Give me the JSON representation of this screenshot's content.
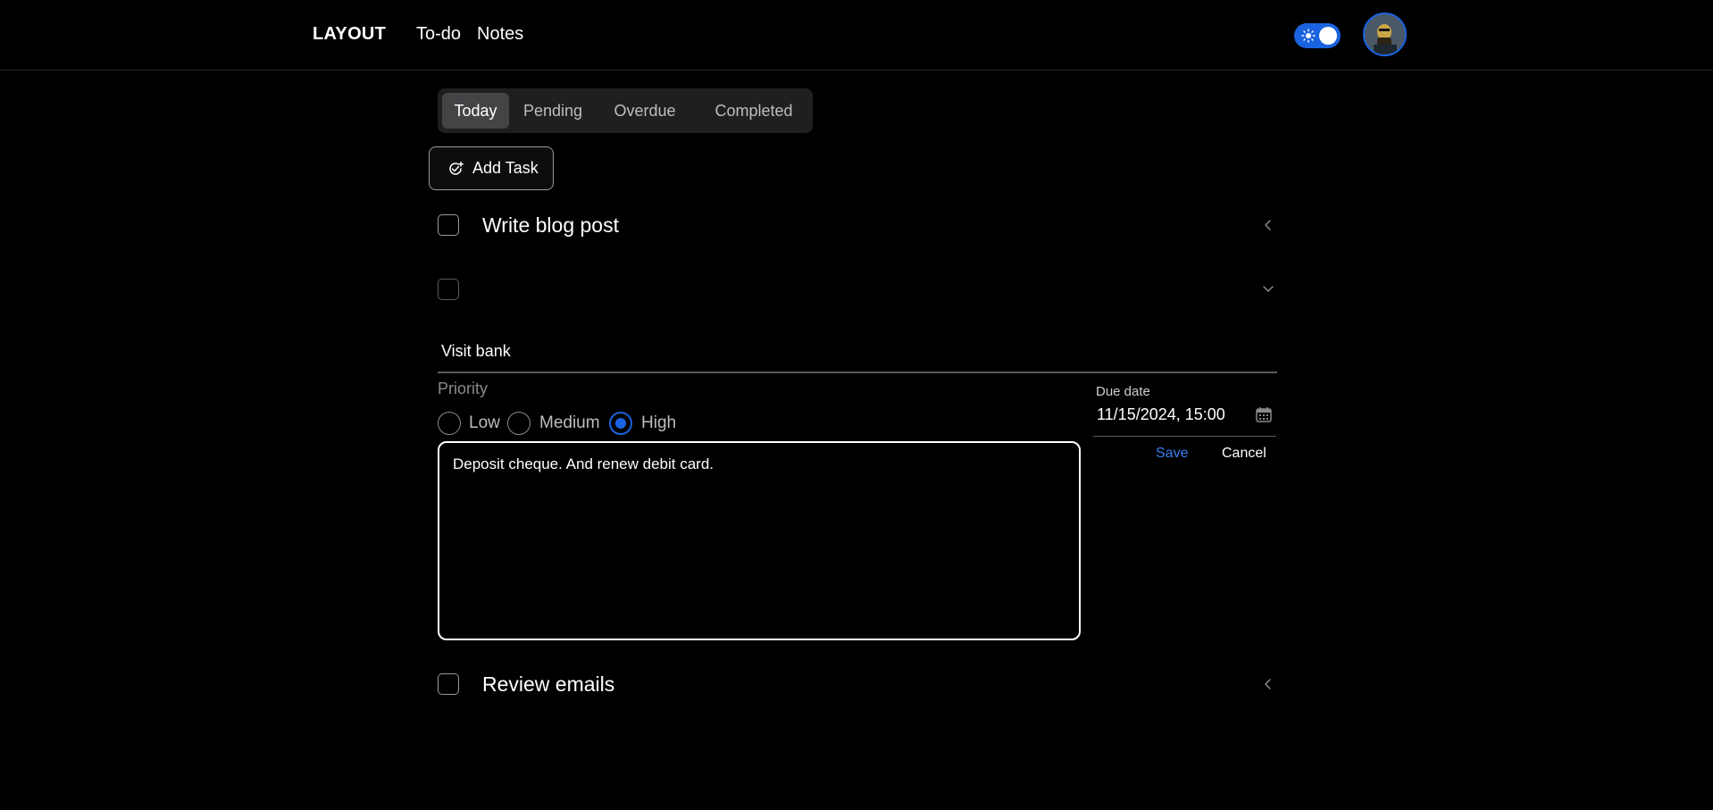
{
  "header": {
    "logo": "LAYOUT",
    "nav": [
      {
        "label": "To-do"
      },
      {
        "label": "Notes"
      }
    ],
    "theme_toggle": {
      "state": "on",
      "icon": "sun-icon"
    },
    "avatar_icon": "user-avatar"
  },
  "tabs": [
    {
      "label": "Today",
      "active": true
    },
    {
      "label": "Pending",
      "active": false
    },
    {
      "label": "Overdue",
      "active": false
    },
    {
      "label": "Completed",
      "active": false
    }
  ],
  "add_task_label": "Add Task",
  "tasks": [
    {
      "title": "Write blog post",
      "checked": false,
      "expanded": false
    },
    {
      "title": "",
      "checked": false,
      "expanded": true
    },
    {
      "title": "Review emails",
      "checked": false,
      "expanded": false
    }
  ],
  "edit_form": {
    "title_value": "Visit bank",
    "priority_label": "Priority",
    "priorities": [
      {
        "label": "Low",
        "checked": false
      },
      {
        "label": "Medium",
        "checked": false
      },
      {
        "label": "High",
        "checked": true
      }
    ],
    "description": "Deposit cheque. And renew debit card.",
    "due_label": "Due date",
    "due_value": "11/15/2024, 15:00",
    "save_label": "Save",
    "cancel_label": "Cancel"
  },
  "colors": {
    "accent": "#1a63e0",
    "background": "#000000",
    "tab_bg": "#1f1f21",
    "tab_active": "#444447"
  }
}
